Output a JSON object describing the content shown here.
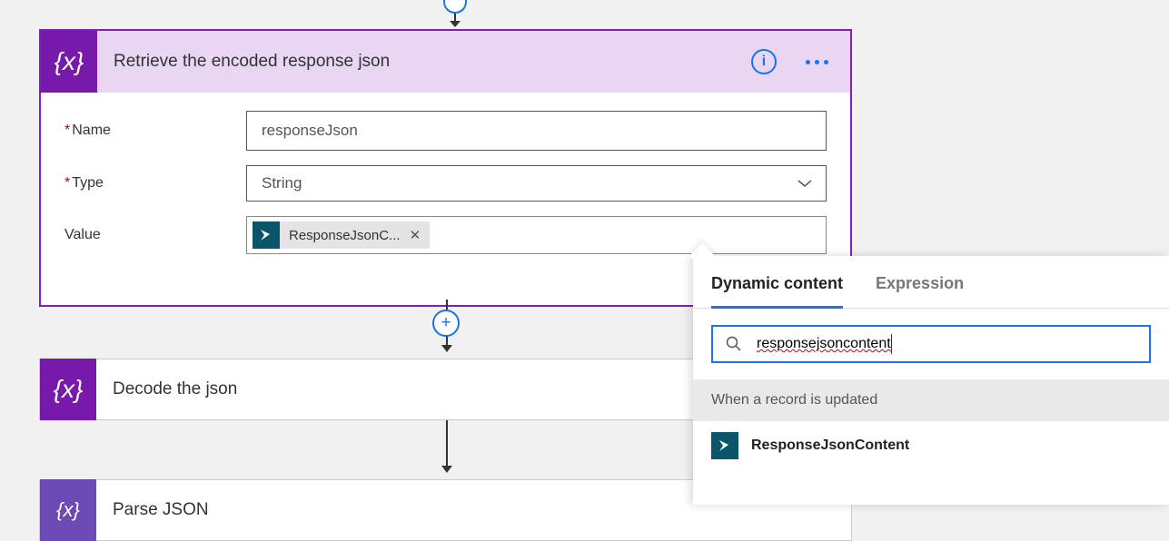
{
  "main_card": {
    "icon_text": "{x}",
    "title": "Retrieve the encoded response json",
    "name_label": "Name",
    "name_value": "responseJson",
    "type_label": "Type",
    "type_value": "String",
    "value_label": "Value",
    "value_pill_text": "ResponseJsonC...",
    "add_action": "Add "
  },
  "card2": {
    "icon_text": "{x}",
    "title": "Decode the json"
  },
  "card3": {
    "icon_text": "{x}",
    "title": "Parse JSON"
  },
  "dynamic_panel": {
    "tab_dynamic": "Dynamic content",
    "tab_expression": "Expression",
    "search_value": "responsejsoncontent",
    "section_header": "When a record is updated",
    "result_label": "ResponseJsonContent"
  }
}
